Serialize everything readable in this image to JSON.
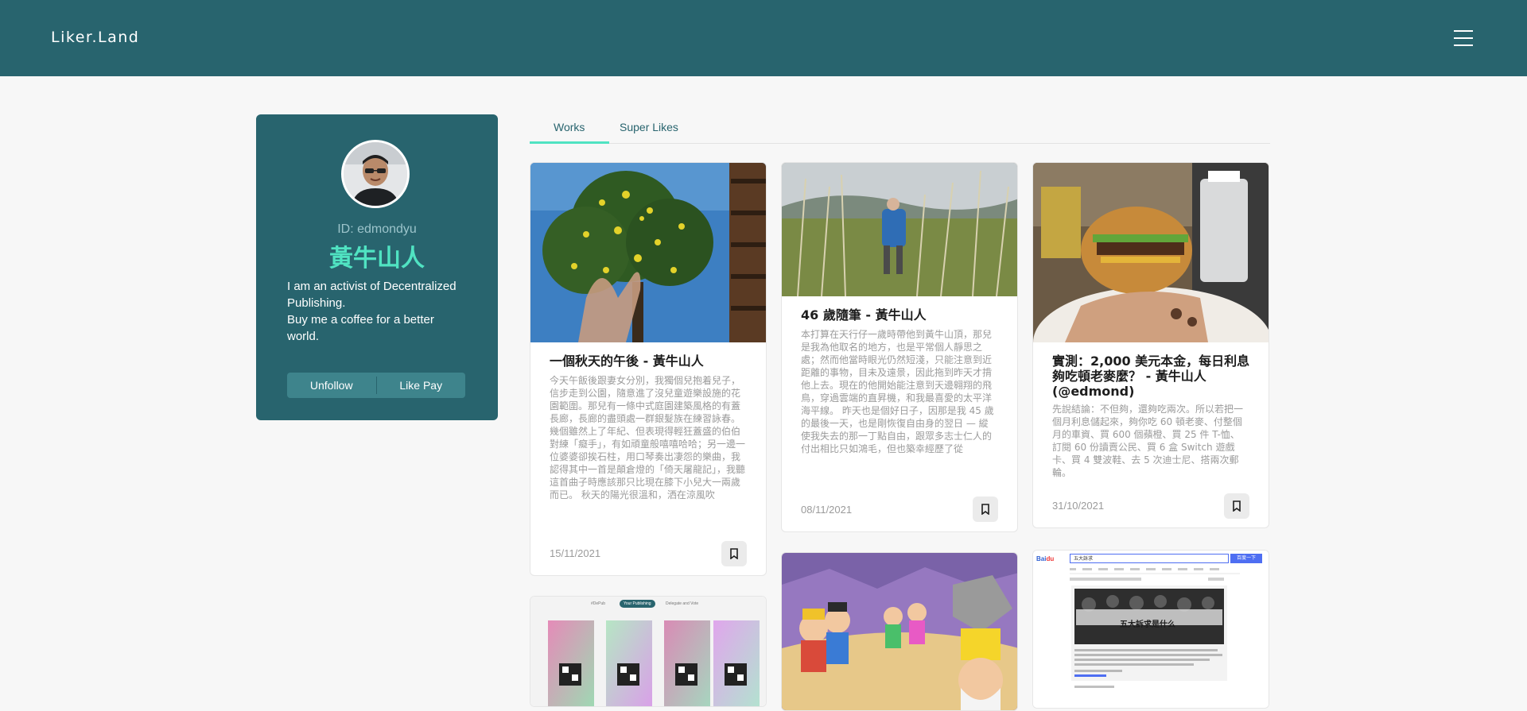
{
  "header": {
    "logo_text": "Liker.Land",
    "menu_icon": "hamburger-menu-icon",
    "bg_color": "#28646e"
  },
  "profile": {
    "id_label": "ID: edmondyu",
    "display_name": "黃牛山人",
    "bio_line1": "I am an activist of Decentralized Publishing.",
    "bio_line2": "Buy me a coffee for a better world.",
    "unfollow_label": "Unfollow",
    "likepay_label": "Like Pay",
    "accent_color": "#50e3c2"
  },
  "tabs": [
    {
      "label": "Works",
      "active": true
    },
    {
      "label": "Super Likes",
      "active": false
    }
  ],
  "cards": [
    {
      "title": "一個秋天的午後 - 黃牛山人",
      "description": "今天午飯後跟妻女分別，我獨個兒抱着兒子，信步走到公園，隨意進了沒兒童遊樂設施的花園範圍。那兒有一條中式庭園建築風格的有蓋長廊，長廊的盡頭處一群銀髮族在練習詠春。幾個雖然上了年紀、但表現得輕狂蓋盛的伯伯對練「癡手」，有如頑童般嘻嘻哈哈；另一邊一位婆婆卻挨石柱，用口琴奏出凄怨的樂曲，我認得其中一首是顛倉燈的「倚天屠龍記」，我聽這首曲子時應該那只比現在膝下小兒大一兩歲而已。 秋天的陽光很溫和，洒在涼風吹",
      "date": "15/11/2021",
      "image_name": "flowering-tree-photo"
    },
    {
      "title": "46 歲隨筆 - 黃牛山人",
      "description": "本打算在天行仔一歲時帶他到黃牛山頂，那兒是我為他取名的地方，也是平常個人靜思之處；然而他當時眼光仍然短淺，只能注意到近距離的事物，目未及遠景，因此拖到昨天才揹他上去。現在的他開始能注意到天邊翱翔的飛鳥，穿過雲端的直昇機，和我最喜愛的太平洋海平線。 昨天也是個好日子，因那是我 45 歲的最後一天，也是剛恢復自由身的翌日 — 縱使我失去的那一丁點自由，跟眾多志士仁人的付出相比只如鴻毛，但也築幸經歷了從",
      "date": "08/11/2021",
      "image_name": "hiker-grassland-photo"
    },
    {
      "title": "實測：2,000 美元本金，每日利息夠吃頓老麥麼？ - 黃牛山人 (@edmond)",
      "description": "先說結論：不但夠，還夠吃兩次。所以若把一個月利息儲起來，夠你吃 60 頓老麥、付整個月的車資、買 600 個蘋橙、買 25 件 T-恤、訂閱 60 份讀賣公民、買 6 盒 Switch 遊戲卡、買 4 雙波鞋、去 5 次迪士尼、搭兩次郵輪。",
      "date": "31/10/2021",
      "image_name": "burger-photo"
    },
    {
      "tab1": "#DePub",
      "tab2": "Your Publishing",
      "tab3": "Delegate and Vote",
      "image_name": "nft-qr-cards-screenshot"
    },
    {
      "image_name": "cartoon-characters-illustration"
    },
    {
      "search_query": "五大訴求",
      "search_button": "百度一下",
      "result_title": "五大訴求是什么",
      "image_name": "baidu-search-screenshot"
    }
  ]
}
